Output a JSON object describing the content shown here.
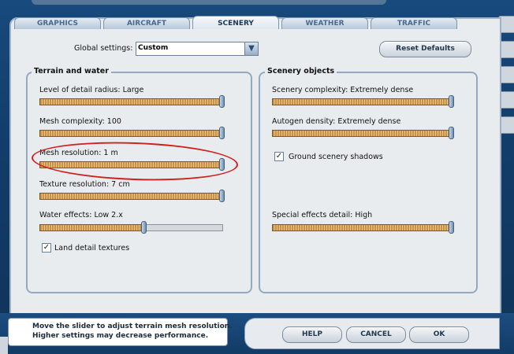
{
  "tabs": [
    "GRAPHICS",
    "AIRCRAFT",
    "SCENERY",
    "WEATHER",
    "TRAFFIC"
  ],
  "active_tab": "SCENERY",
  "global_settings": {
    "label": "Global settings:",
    "value": "Custom"
  },
  "reset_button": "Reset Defaults",
  "terrain": {
    "title": "Terrain and water",
    "sliders": [
      {
        "label": "Level of detail radius: Large",
        "value": 1.0
      },
      {
        "label": "Mesh complexity: 100",
        "value": 1.0
      },
      {
        "label": "Mesh resolution: 1 m",
        "value": 1.0
      },
      {
        "label": "Texture resolution: 7 cm",
        "value": 1.0
      },
      {
        "label": "Water effects: Low 2.x",
        "value": 0.57
      }
    ],
    "checkbox": {
      "label": "Land detail textures",
      "checked": "✓"
    }
  },
  "scenery": {
    "title": "Scenery objects",
    "sliders": [
      {
        "label": "Scenery complexity: Extremely dense",
        "value": 1.0
      },
      {
        "label": "Autogen density: Extremely dense",
        "value": 1.0
      },
      {
        "label": "Special effects detail: High",
        "value": 1.0
      }
    ],
    "checkbox": {
      "label": "Ground scenery shadows",
      "checked": "✓"
    }
  },
  "tip": {
    "line1": "Move the slider to adjust terrain mesh resolution.",
    "line2": "Higher settings may decrease performance."
  },
  "buttons": {
    "help": "HELP",
    "cancel": "CANCEL",
    "ok": "OK"
  },
  "colors": {
    "accent": "#184a7d",
    "annotation": "#d21f1f"
  },
  "icons": {
    "dropdown": "chevron-down-icon",
    "check": "checkmark-icon"
  }
}
